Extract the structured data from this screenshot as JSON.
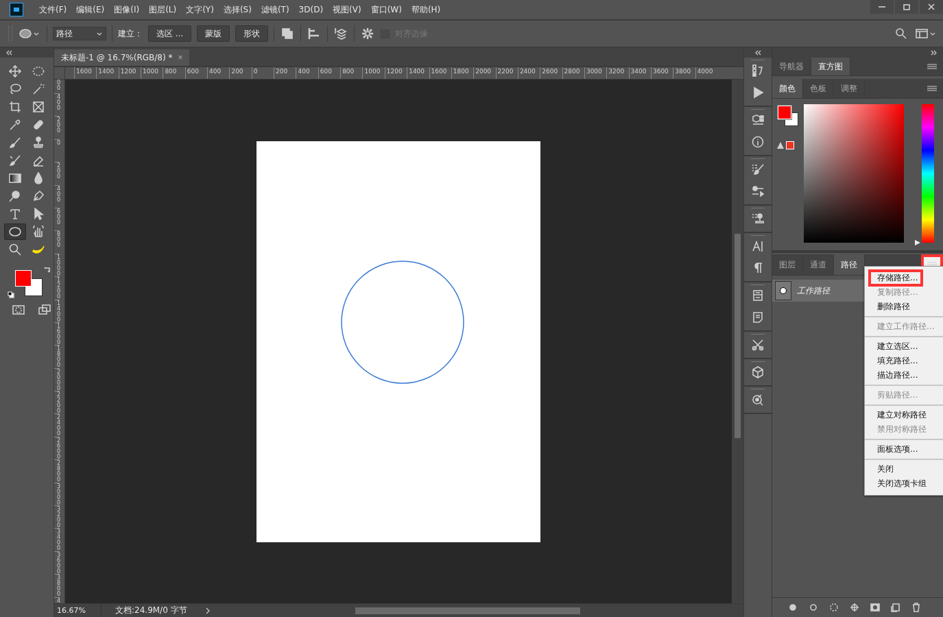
{
  "menu_bar": {
    "items": [
      "文件(F)",
      "编辑(E)",
      "图像(I)",
      "图层(L)",
      "文字(Y)",
      "选择(S)",
      "滤镜(T)",
      "3D(D)",
      "视图(V)",
      "窗口(W)",
      "帮助(H)"
    ]
  },
  "options_bar": {
    "mode": "路径",
    "make_label": "建立：",
    "buttons": [
      "选区 ...",
      "蒙版",
      "形状"
    ],
    "align_edges": {
      "label": "对齐边缘",
      "checked": false,
      "disabled": true
    }
  },
  "document_tab": {
    "title": "未标题-1 @ 16.7%(RGB/8) *",
    "close": "×"
  },
  "rulers": {
    "horizontal": [
      "1600",
      "1400",
      "1200",
      "1000",
      "800",
      "600",
      "400",
      "200",
      "0",
      "200",
      "400",
      "600",
      "800",
      "1000",
      "1200",
      "1400",
      "1600",
      "1800",
      "2000",
      "2200",
      "2400",
      "2600",
      "2800",
      "3000",
      "3200",
      "3400",
      "3600",
      "3800",
      "4000"
    ],
    "vertical": [
      "00",
      "400",
      "200",
      "0",
      "200",
      "400",
      "600",
      "800",
      "1000",
      "1200",
      "1400",
      "1600",
      "1800",
      "2000",
      "2200",
      "2400",
      "2600",
      "2800",
      "3000",
      "3200",
      "3400",
      "3600",
      "3800",
      "4"
    ]
  },
  "tools": [
    {
      "selected": false
    },
    {
      "selected": false
    },
    {
      "selected": false
    },
    {
      "selected": false
    },
    {
      "selected": false
    },
    {
      "selected": false
    },
    {
      "selected": false
    },
    {
      "selected": false
    },
    {
      "selected": false
    },
    {
      "selected": false
    },
    {
      "selected": false
    },
    {
      "selected": false
    },
    {
      "selected": false
    },
    {
      "selected": false
    },
    {
      "selected": false
    },
    {
      "selected": false
    },
    {
      "selected": false
    },
    {
      "selected": false
    },
    {
      "selected": true
    },
    {
      "selected": false
    },
    {
      "selected": false
    },
    {
      "selected": false
    }
  ],
  "panels": {
    "top_tabs": [
      {
        "label": "导航器",
        "selected": false
      },
      {
        "label": "直方图",
        "selected": true
      }
    ],
    "color_tabs": [
      {
        "label": "颜色",
        "selected": true
      },
      {
        "label": "色板",
        "selected": false
      },
      {
        "label": "调整",
        "selected": false
      }
    ],
    "paths_tabs": [
      {
        "label": "图层",
        "selected": false
      },
      {
        "label": "通道",
        "selected": false
      },
      {
        "label": "路径",
        "selected": true
      }
    ],
    "paths": [
      {
        "name": "工作路径",
        "selected": true
      }
    ],
    "hue_slider": {
      "level": 0
    }
  },
  "context_menu": {
    "button_highlighted": true,
    "groups": [
      [
        {
          "label": "存储路径...",
          "disabled": false,
          "highlighted": true
        },
        {
          "label": "复制路径...",
          "disabled": true,
          "highlighted": false
        },
        {
          "label": "删除路径",
          "disabled": false,
          "highlighted": false
        }
      ],
      [
        {
          "label": "建立工作路径...",
          "disabled": true,
          "highlighted": false
        }
      ],
      [
        {
          "label": "建立选区...",
          "disabled": false,
          "highlighted": false
        },
        {
          "label": "填充路径...",
          "disabled": false,
          "highlighted": false
        },
        {
          "label": "描边路径...",
          "disabled": false,
          "highlighted": false
        }
      ],
      [
        {
          "label": "剪贴路径...",
          "disabled": true,
          "highlighted": false
        }
      ],
      [
        {
          "label": "建立对称路径",
          "disabled": false,
          "highlighted": false
        },
        {
          "label": "禁用对称路径",
          "disabled": true,
          "highlighted": false
        }
      ],
      [
        {
          "label": "面板选项...",
          "disabled": false,
          "highlighted": false
        }
      ],
      [
        {
          "label": "关闭",
          "disabled": false,
          "highlighted": false
        },
        {
          "label": "关闭选项卡组",
          "disabled": false,
          "highlighted": false
        }
      ]
    ]
  },
  "status_bar": {
    "zoom": "16.67%",
    "doc_info": "文档:24.9M/0 字节"
  }
}
